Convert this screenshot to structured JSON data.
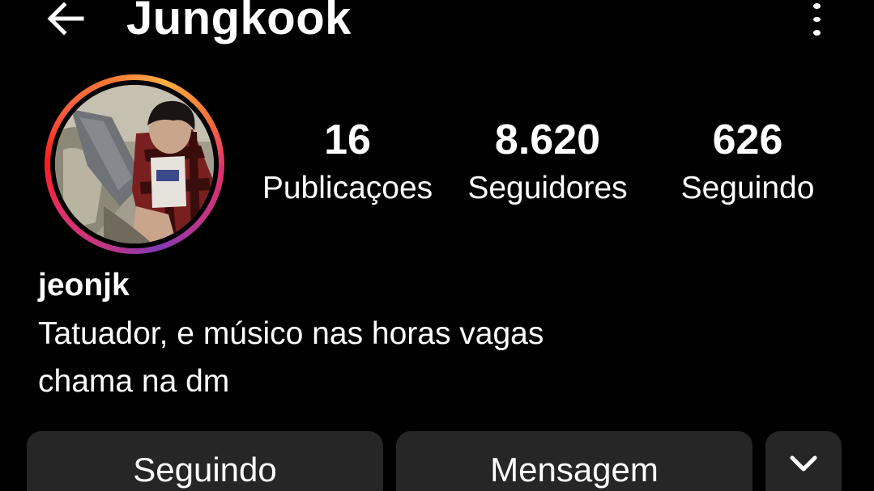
{
  "header": {
    "title": "Jungkook",
    "back_icon": "arrow-left-icon",
    "menu_icon": "more-vertical-icon"
  },
  "profile": {
    "avatar_ring_colors": [
      "#c13584",
      "#e1306c",
      "#f77737",
      "#fcaf45"
    ],
    "stats": {
      "posts": {
        "value": "16",
        "label": "Publicaçoes"
      },
      "followers": {
        "value": "8.620",
        "label": "Seguidores"
      },
      "following": {
        "value": "626",
        "label": "Seguindo"
      }
    },
    "username": "jeonjk",
    "bio": [
      "Tatuador, e músico nas horas vagas",
      "chama na dm"
    ]
  },
  "actions": {
    "following_label": "Seguindo",
    "message_label": "Mensagem",
    "more_icon": "chevron-down-icon",
    "button_color": "#262626"
  }
}
